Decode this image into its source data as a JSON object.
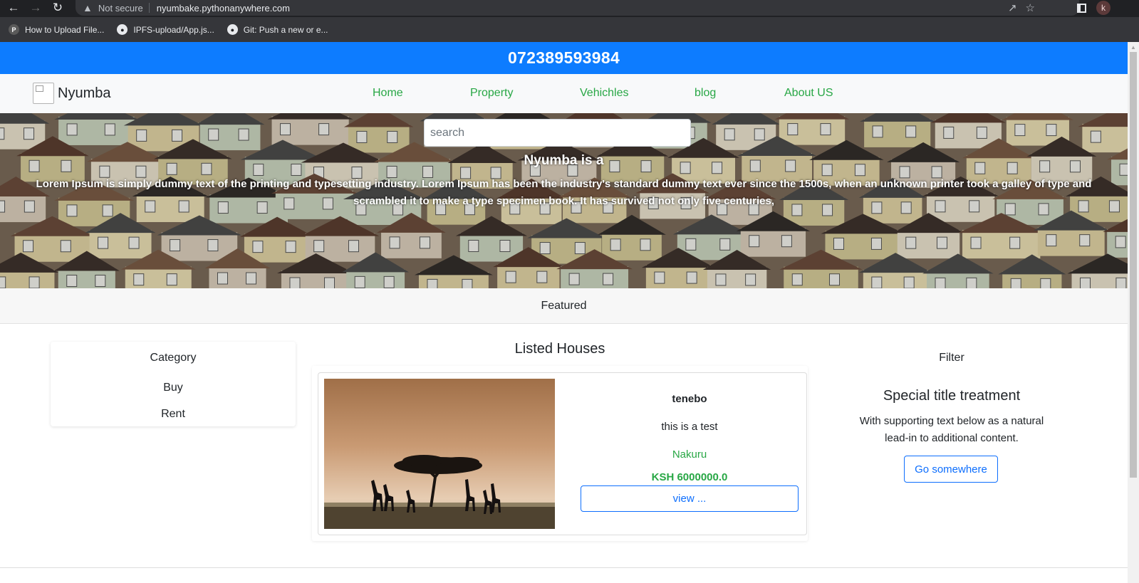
{
  "browser": {
    "security_label": "Not secure",
    "url": "nyumbake.pythonanywhere.com",
    "profile_initial": "k",
    "bookmarks": [
      {
        "label": "How to Upload File..."
      },
      {
        "label": "IPFS-upload/App.js..."
      },
      {
        "label": "Git: Push a new or e..."
      }
    ]
  },
  "site": {
    "phone": "072389593984",
    "brand": "Nyumba",
    "nav": [
      "Home",
      "Property",
      "Vehichles",
      "blog",
      "About US"
    ],
    "search_placeholder": "search",
    "hero_title": "Nyumba is a",
    "hero_text": "Lorem Ipsum is simply dummy text of the printing and typesetting industry. Lorem Ipsum has been the industry's standard dummy text ever since the 1500s, when an unknown printer took a galley of type and scrambled it to make a type specimen book. It has survived not only five centuries,",
    "featured": "Featured"
  },
  "category": {
    "title": "Category",
    "items": [
      "Buy",
      "Rent"
    ]
  },
  "listings": {
    "title": "Listed Houses",
    "houses": [
      {
        "name": "tenebo",
        "description": "this is a test",
        "location": "Nakuru",
        "price": "KSH 6000000.0",
        "button": "view ..."
      }
    ]
  },
  "filter": {
    "title": "Filter",
    "card_title": "Special title treatment",
    "card_text": "With supporting text below as a natural lead-in to additional content.",
    "button": "Go somewhere"
  },
  "colors": {
    "phone_bar": "#0d7cff",
    "nav_link": "#28a745",
    "primary": "#0d6efd"
  }
}
